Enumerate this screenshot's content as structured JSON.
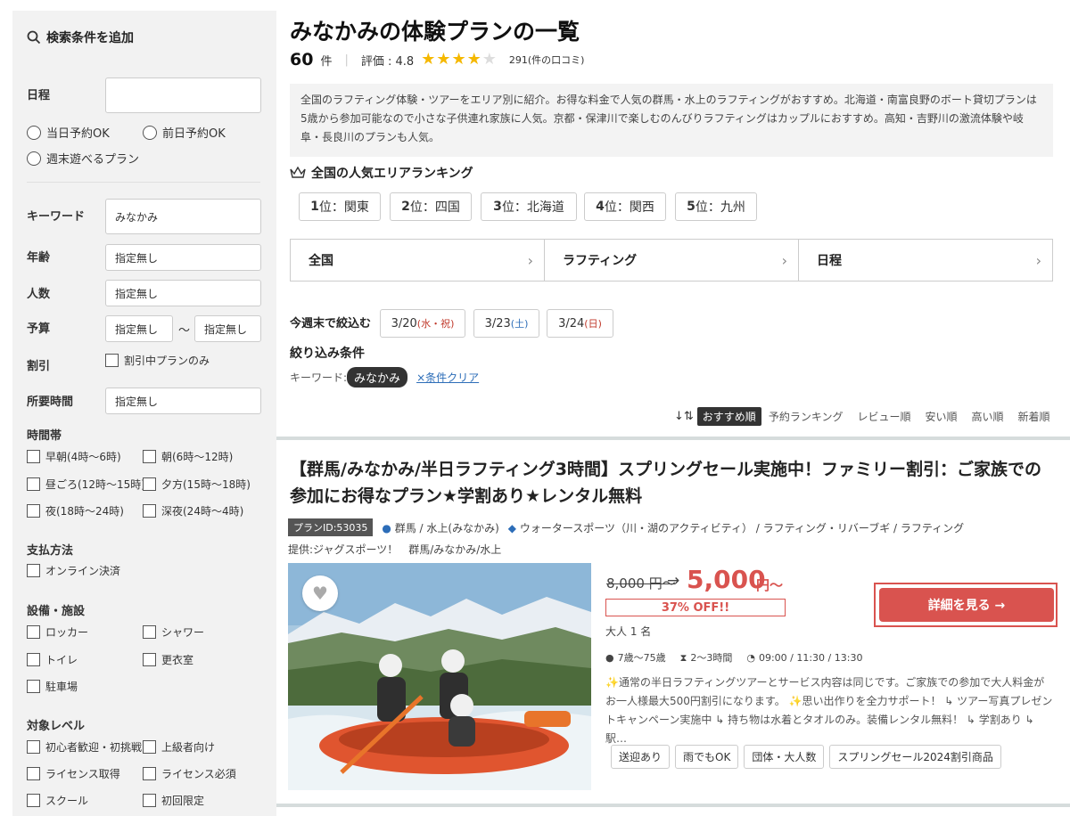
{
  "sidebar": {
    "heading": "検索条件を追加",
    "date_label": "日程",
    "date_value": "",
    "radios": [
      "当日予約OK",
      "前日予約OK",
      "週末遊べるプラン"
    ],
    "keyword_label": "キーワード",
    "keyword_value": "みなかみ",
    "age_label": "年齢",
    "age_value": "指定無し",
    "people_label": "人数",
    "people_value": "指定無し",
    "budget_label": "予算",
    "budget_min": "指定無し",
    "budget_tilde": "〜",
    "budget_max": "指定無し",
    "discount_label": "割引",
    "discount_option": "割引中プランのみ",
    "duration_label": "所要時間",
    "duration_value": "指定無し",
    "time_label": "時間帯",
    "time_options": [
      "早朝(4時〜6時)",
      "朝(6時〜12時)",
      "昼ごろ(12時〜15時)",
      "夕方(15時〜18時)",
      "夜(18時〜24時)",
      "深夜(24時〜4時)"
    ],
    "payment_label": "支払方法",
    "payment_options": [
      "オンライン決済"
    ],
    "facility_label": "設備・施設",
    "facility_options": [
      "ロッカー",
      "シャワー",
      "トイレ",
      "更衣室",
      "駐車場"
    ],
    "level_label": "対象レベル",
    "level_options": [
      "初心者歓迎・初挑戦",
      "上級者向け",
      "ライセンス取得",
      "ライセンス必須",
      "スクール",
      "初回限定"
    ]
  },
  "main": {
    "title": "みなかみの体験プランの一覧",
    "count": "60",
    "count_unit": "件",
    "rating_label": "評価 : 4.8",
    "rating_value": 4.8,
    "reviews": "291(件の口コミ)",
    "description": "全国のラフティング体験・ツアーをエリア別に紹介。お得な料金で人気の群馬・水上のラフティングがおすすめ。北海道・南富良野のボート貸切プランは5歳から参加可能なので小さな子供連れ家族に人気。京都・保津川で楽しむのんびりラフティングはカップルにおすすめ。高知・吉野川の激流体験や岐阜・長良川のプランも人気。",
    "ranking_title": "全国の人気エリアランキング",
    "rankings": [
      {
        "rank": "1",
        "suffix": "位：関東"
      },
      {
        "rank": "2",
        "suffix": "位：四国"
      },
      {
        "rank": "3",
        "suffix": "位：北海道"
      },
      {
        "rank": "4",
        "suffix": "位：関西"
      },
      {
        "rank": "5",
        "suffix": "位：九州"
      }
    ],
    "selectors": [
      "全国",
      "ラフティング",
      "日程"
    ],
    "weekend_label": "今週末で絞込む",
    "weekend_dates": [
      {
        "date": "3/20",
        "day": "(水・祝)",
        "color": "red"
      },
      {
        "date": "3/23",
        "day": "(土)",
        "color": "blue"
      },
      {
        "date": "3/24",
        "day": "(日)",
        "color": "red"
      }
    ],
    "filter_title": "絞り込み条件",
    "filter_keyword_label": "キーワード:",
    "filter_keyword_value": "みなかみ",
    "filter_clear": "×条件クリア",
    "sort_options": [
      "おすすめ順",
      "予約ランキング",
      "レビュー順",
      "安い順",
      "高い順",
      "新着順"
    ],
    "sort_active": "おすすめ順"
  },
  "card": {
    "title": "【群馬/みなかみ/半日ラフティング3時間】スプリングセール実施中！ファミリー割引：ご家族での参加にお得なプラン★学割あり★レンタル無料",
    "plan_id": "プランID:53035",
    "location": "群馬 / 水上(みなかみ)",
    "category": "ウォータースポーツ（川・湖のアクティビティ） / ラフティング・リバーブギ / ラフティング",
    "provider": "提供:ジャグスポーツ！　群馬/みなかみ/水上",
    "old_price": "8,000 円〜",
    "arrow": "→",
    "new_price": "5,000",
    "new_price_unit": "円〜",
    "discount": "37% OFF!!",
    "per_person": "大人 1 名",
    "detail_button": "詳細を見る →",
    "age_range": "7歳〜75歳",
    "duration": "2〜3時間",
    "start_times": "09:00 / 11:30 / 13:30",
    "description": "✨通常の半日ラフティングツアーとサービス内容は同じです。ご家族での参加で大人料金がお一人様最大500円割引になります。 ✨思い出作りを全力サポート！ ↳ ツアー写真プレゼントキャンペーン実施中 ↳ 持ち物は水着とタオルのみ。装備レンタル無料！ ↳ 学割あり ↳ 駅…",
    "tags": [
      "送迎あり",
      "雨でもOK",
      "団体・大人数",
      "スプリングセール2024割引商品"
    ]
  },
  "colors": {
    "accent": "#d9534f",
    "star": "#f5b800",
    "link": "#2c6db8"
  }
}
